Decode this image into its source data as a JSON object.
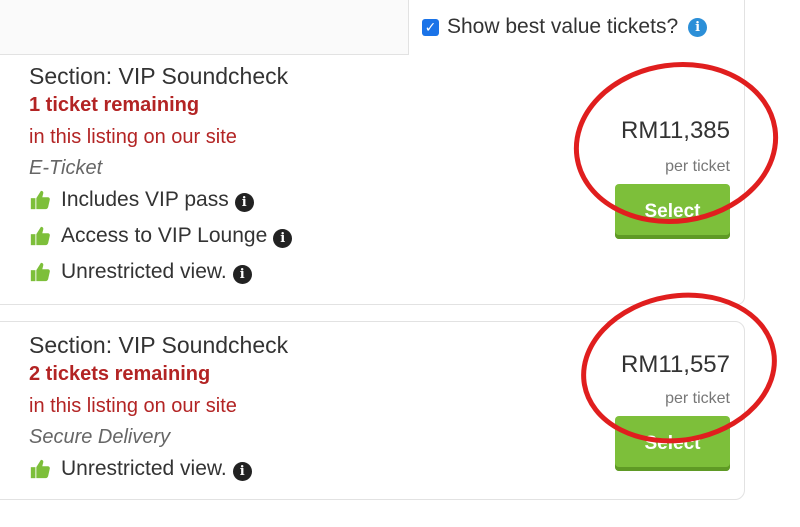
{
  "best_value": {
    "label": "Show best value tickets?",
    "checked": true,
    "info_icon": "info-icon"
  },
  "listings": [
    {
      "section": "Section: VIP Soundcheck",
      "remaining": "1 ticket remaining",
      "site_note": "in this listing on our site",
      "delivery": "E-Ticket",
      "features": [
        "Includes VIP pass",
        "Access to VIP Lounge",
        "Unrestricted view."
      ],
      "price": "RM11,385",
      "per_ticket": "per ticket",
      "select_label": "Select"
    },
    {
      "section": "Section: VIP Soundcheck",
      "remaining": "2 tickets remaining",
      "site_note": "in this listing on our site",
      "delivery": "Secure Delivery",
      "features": [
        "Unrestricted view."
      ],
      "price": "RM11,557",
      "per_ticket": "per ticket",
      "select_label": "Select"
    }
  ],
  "colors": {
    "accent_red": "#b32424",
    "select_green": "#7dbf3a",
    "annotation_red": "#e01e1e",
    "checkbox_blue": "#1a73e8"
  },
  "icons": {
    "feature": "thumbs-up-icon",
    "feature_info": "info-icon"
  }
}
